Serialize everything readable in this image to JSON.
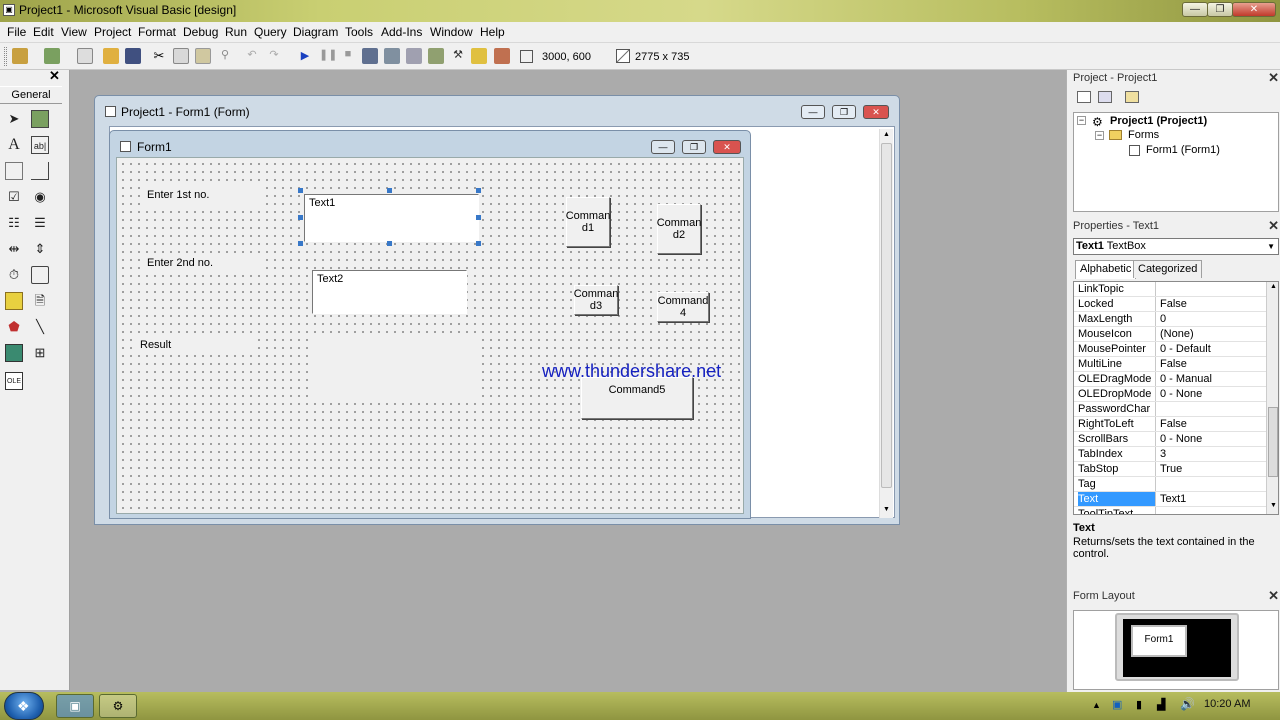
{
  "window": {
    "title": "Project1 - Microsoft Visual Basic [design]"
  },
  "menu": [
    "File",
    "Edit",
    "View",
    "Project",
    "Format",
    "Debug",
    "Run",
    "Query",
    "Diagram",
    "Tools",
    "Add-Ins",
    "Window",
    "Help"
  ],
  "toolbar": {
    "position_readout": "3000, 600",
    "size_readout": "2775 x 735"
  },
  "toolbox": {
    "tab_label": "General"
  },
  "designer": {
    "outer_title": "Project1 - Form1 (Form)",
    "form_title": "Form1",
    "label1": "Enter 1st no.",
    "label2": "Enter 2nd no.",
    "label3": "Result",
    "text1": "Text1",
    "text2": "Text2",
    "cmd1": "Comman\nd1",
    "cmd2": "Comman\nd2",
    "cmd3": "Comman\nd3",
    "cmd4": "Command\n4",
    "cmd5": "Command5",
    "watermark": "www.thundershare.net"
  },
  "project_panel": {
    "title": "Project - Project1",
    "root": "Project1 (Project1)",
    "folder": "Forms",
    "item": "Form1 (Form1)"
  },
  "properties_panel": {
    "title": "Properties - Text1",
    "object_name": "Text1",
    "object_type": "TextBox",
    "tabs": [
      "Alphabetic",
      "Categorized"
    ],
    "rows": [
      {
        "name": "LinkTopic",
        "value": ""
      },
      {
        "name": "Locked",
        "value": "False"
      },
      {
        "name": "MaxLength",
        "value": "0"
      },
      {
        "name": "MouseIcon",
        "value": "(None)"
      },
      {
        "name": "MousePointer",
        "value": "0 - Default"
      },
      {
        "name": "MultiLine",
        "value": "False"
      },
      {
        "name": "OLEDragMode",
        "value": "0 - Manual"
      },
      {
        "name": "OLEDropMode",
        "value": "0 - None"
      },
      {
        "name": "PasswordChar",
        "value": ""
      },
      {
        "name": "RightToLeft",
        "value": "False"
      },
      {
        "name": "ScrollBars",
        "value": "0 - None"
      },
      {
        "name": "TabIndex",
        "value": "3"
      },
      {
        "name": "TabStop",
        "value": "True"
      },
      {
        "name": "Tag",
        "value": ""
      },
      {
        "name": "Text",
        "value": "Text1"
      },
      {
        "name": "ToolTipText",
        "value": ""
      }
    ],
    "selected_row": 14,
    "desc_title": "Text",
    "desc_body": "Returns/sets the text contained in the control."
  },
  "form_layout": {
    "title": "Form Layout",
    "form_label": "Form1"
  },
  "taskbar": {
    "clock": "10:20 AM"
  },
  "colors": {
    "selection": "#3399ff",
    "watermark": "#1520c0"
  }
}
